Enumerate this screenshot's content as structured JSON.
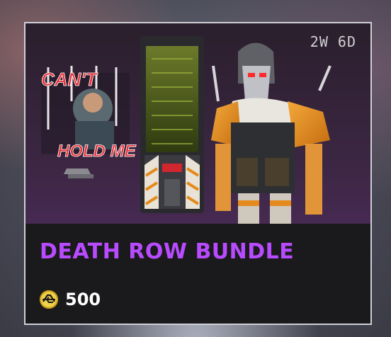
{
  "bundle": {
    "time_remaining": "2W 6D",
    "title": "DEATH ROW BUNDLE",
    "price": "500",
    "currency_icon": "apex-coins-icon",
    "accent_color": "#b84bff",
    "coin_color": "#f0d14a"
  },
  "art": {
    "banner_text_top": "CAN'T",
    "banner_text_bottom": "HOLD ME"
  }
}
